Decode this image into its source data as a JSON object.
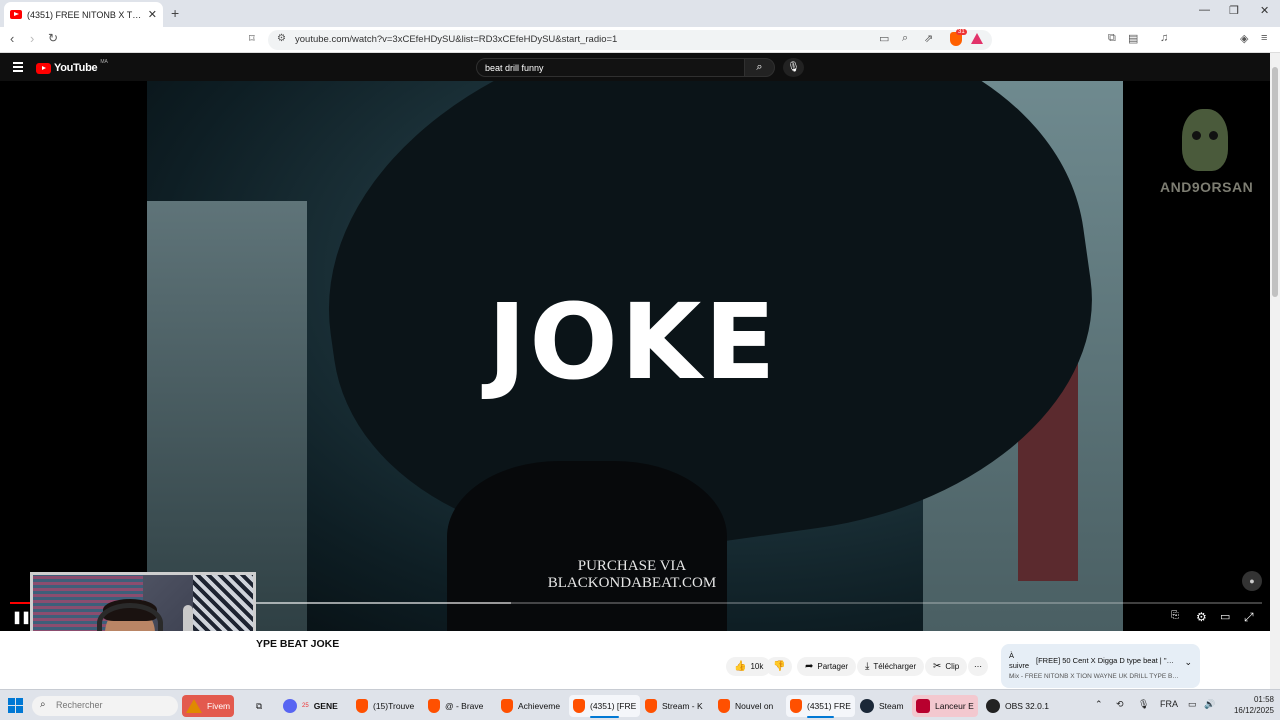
{
  "browser": {
    "tab_title": "(4351) FREE NITONB X TION",
    "new_tab": "+",
    "close_tab": "✕",
    "window_controls": [
      "—",
      "❐",
      "✕"
    ],
    "url": "youtube.com/watch?v=3xCEfeHDySU&list=RD3xCEfeHDySU&start_radio=1",
    "brave_badge": "31"
  },
  "youtube": {
    "logo_text": "YouTube",
    "country_code": "MA",
    "search_value": "beat drill funny"
  },
  "video": {
    "overlay_title": "JOKE",
    "overlay_line1": "PURCHASE VIA",
    "overlay_line2": "BLACKONDABEAT.COM",
    "watermark_text": "AND9ORSAN",
    "progress_played": 0.02,
    "progress_buffered": 0.4,
    "visible_title": "YPE BEAT JOKE"
  },
  "actions": {
    "likes": "10k",
    "share": "Partager",
    "download": "Télécharger",
    "clip": "Clip",
    "more": "⋯"
  },
  "up_next": {
    "label": "À suivre :",
    "title": "[FREE] 50 Cent X Digga D type beat | \"Tropi...",
    "subtitle": "Mix - FREE NITONB X TION WAYNE UK DRILL TYPE BEAT JO..."
  },
  "taskbar": {
    "search_placeholder": "Rechercher",
    "items": [
      {
        "label": "Fivem"
      },
      {
        "label": "GENE"
      },
      {
        "label": "(15)Trouve"
      },
      {
        "label": "@ - Brave"
      },
      {
        "label": "Achieveme"
      },
      {
        "label": "(4351) [FRE"
      },
      {
        "label": "Stream - K"
      },
      {
        "label": "Nouvel on"
      },
      {
        "label": "(4351) FRE"
      },
      {
        "label": "Steam"
      },
      {
        "label": "Lanceur E"
      },
      {
        "label": "OBS 32.0.1"
      }
    ],
    "discord_badge": "25",
    "language": "FRA",
    "time": "01:58",
    "date": "16/12/2025"
  },
  "colors": {
    "youtube_red": "#ff0000",
    "brave_orange": "#ff5000",
    "windows_blue": "#0078d4"
  }
}
